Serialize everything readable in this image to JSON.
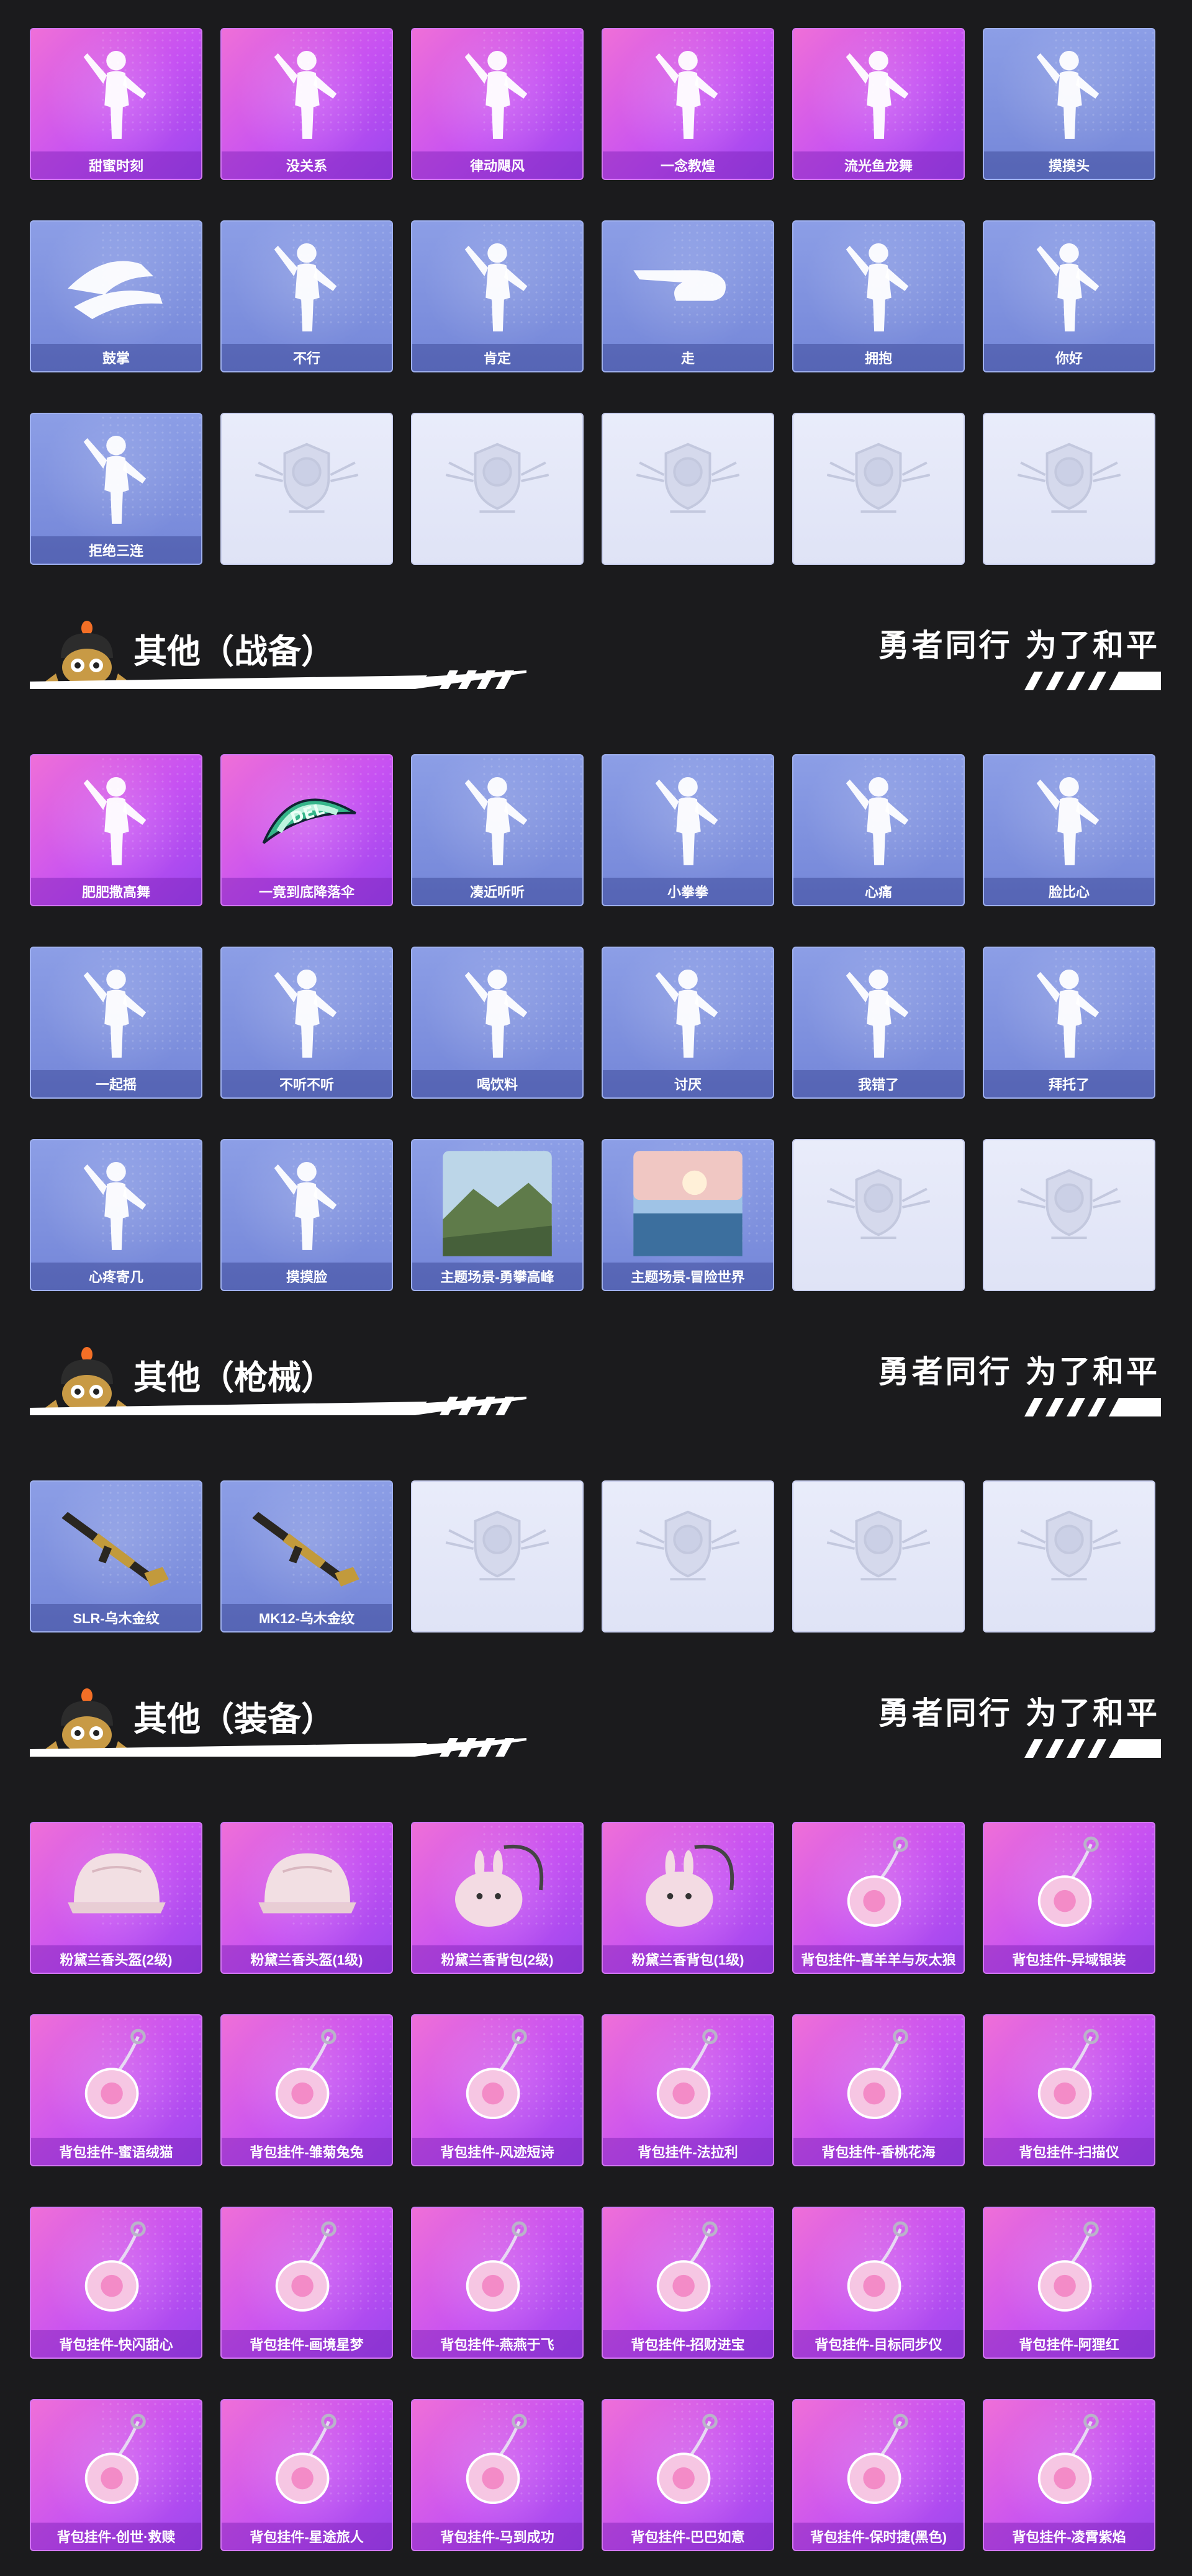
{
  "sections": [
    {
      "title": "其他（战备）",
      "slogan": "勇者同行 为了和平"
    },
    {
      "title": "其他（枪械）",
      "slogan": "勇者同行 为了和平"
    },
    {
      "title": "其他（装备）",
      "slogan": "勇者同行 为了和平"
    }
  ],
  "grid1": [
    {
      "label": "甜蜜时刻",
      "style": "pink",
      "icon": "dancer-figure-icon"
    },
    {
      "label": "没关系",
      "style": "pink",
      "icon": "dancer-figure-icon"
    },
    {
      "label": "律动飓风",
      "style": "pink",
      "icon": "dancer-figure-icon"
    },
    {
      "label": "一念教煌",
      "style": "pink",
      "icon": "dancer-figure-icon"
    },
    {
      "label": "流光鱼龙舞",
      "style": "pink",
      "icon": "dancer-figure-icon"
    },
    {
      "label": "摸摸头",
      "style": "blue",
      "icon": "figure-pat-head-icon"
    },
    {
      "label": "鼓掌",
      "style": "blue",
      "icon": "clapping-hands-icon"
    },
    {
      "label": "不行",
      "style": "blue",
      "icon": "head-shake-icon"
    },
    {
      "label": "肯定",
      "style": "blue",
      "icon": "head-nod-icon"
    },
    {
      "label": "走",
      "style": "blue",
      "icon": "pointing-hand-icon"
    },
    {
      "label": "拥抱",
      "style": "blue",
      "icon": "hug-figure-icon"
    },
    {
      "label": "你好",
      "style": "blue",
      "icon": "wave-figure-icon"
    },
    {
      "label": "拒绝三连",
      "style": "blue",
      "icon": "crossed-arms-figure-icon"
    },
    {
      "label": "",
      "style": "empty",
      "icon": "emblem-placeholder-icon"
    },
    {
      "label": "",
      "style": "empty",
      "icon": "emblem-placeholder-icon"
    },
    {
      "label": "",
      "style": "empty",
      "icon": "emblem-placeholder-icon"
    },
    {
      "label": "",
      "style": "empty",
      "icon": "emblem-placeholder-icon"
    },
    {
      "label": "",
      "style": "empty",
      "icon": "emblem-placeholder-icon"
    }
  ],
  "grid2": [
    {
      "label": "肥肥撒高舞",
      "style": "pink",
      "icon": "dancer-figure-icon"
    },
    {
      "label": "一竟到底降落伞",
      "style": "pink",
      "icon": "parachute-icon"
    },
    {
      "label": "凑近听听",
      "style": "blue",
      "icon": "listen-figure-icon"
    },
    {
      "label": "小拳拳",
      "style": "blue",
      "icon": "fist-figure-icon"
    },
    {
      "label": "心痛",
      "style": "blue",
      "icon": "heartache-figure-icon"
    },
    {
      "label": "脸比心",
      "style": "blue",
      "icon": "heart-face-figure-icon"
    },
    {
      "label": "一起摇",
      "style": "blue",
      "icon": "sway-figure-icon"
    },
    {
      "label": "不听不听",
      "style": "blue",
      "icon": "cover-ears-figure-icon"
    },
    {
      "label": "喝饮料",
      "style": "blue",
      "icon": "drink-figure-icon"
    },
    {
      "label": "讨厌",
      "style": "blue",
      "icon": "annoyed-figure-icon"
    },
    {
      "label": "我错了",
      "style": "blue",
      "icon": "sorry-figure-icon"
    },
    {
      "label": "拜托了",
      "style": "blue",
      "icon": "pray-figure-icon"
    },
    {
      "label": "心疼寄几",
      "style": "blue",
      "icon": "self-hug-figure-icon"
    },
    {
      "label": "摸摸脸",
      "style": "blue",
      "icon": "touch-face-figure-icon"
    },
    {
      "label": "主题场景-勇攀高峰",
      "style": "blue",
      "icon": "mountain-scene-icon"
    },
    {
      "label": "主题场景-冒险世界",
      "style": "blue",
      "icon": "sea-scene-icon"
    },
    {
      "label": "",
      "style": "empty",
      "icon": "emblem-placeholder-icon"
    },
    {
      "label": "",
      "style": "empty",
      "icon": "emblem-placeholder-icon"
    }
  ],
  "grid3": [
    {
      "label": "SLR-乌木金纹",
      "style": "blue",
      "icon": "rifle-icon"
    },
    {
      "label": "MK12-乌木金纹",
      "style": "blue",
      "icon": "rifle-icon"
    },
    {
      "label": "",
      "style": "empty",
      "icon": "emblem-placeholder-icon"
    },
    {
      "label": "",
      "style": "empty",
      "icon": "emblem-placeholder-icon"
    },
    {
      "label": "",
      "style": "empty",
      "icon": "emblem-placeholder-icon"
    },
    {
      "label": "",
      "style": "empty",
      "icon": "emblem-placeholder-icon"
    }
  ],
  "grid4": [
    {
      "label": "粉黛兰香头盔(2级)",
      "style": "pink",
      "icon": "helmet-icon"
    },
    {
      "label": "粉黛兰香头盔(1级)",
      "style": "pink",
      "icon": "helmet-icon"
    },
    {
      "label": "粉黛兰香背包(2级)",
      "style": "pink",
      "icon": "backpack-icon"
    },
    {
      "label": "粉黛兰香背包(1级)",
      "style": "pink",
      "icon": "backpack-icon"
    },
    {
      "label": "背包挂件-喜羊羊与灰太狼",
      "style": "pink",
      "icon": "charm-icon"
    },
    {
      "label": "背包挂件-异域银装",
      "style": "pink",
      "icon": "charm-icon"
    },
    {
      "label": "背包挂件-蜜语绒猫",
      "style": "pink",
      "icon": "charm-icon"
    },
    {
      "label": "背包挂件-雏菊兔兔",
      "style": "pink",
      "icon": "charm-icon"
    },
    {
      "label": "背包挂件-风迹短诗",
      "style": "pink",
      "icon": "charm-icon"
    },
    {
      "label": "背包挂件-法拉利",
      "style": "pink",
      "icon": "charm-icon"
    },
    {
      "label": "背包挂件-香桃花海",
      "style": "pink",
      "icon": "charm-icon"
    },
    {
      "label": "背包挂件-扫描仪",
      "style": "pink",
      "icon": "charm-icon"
    },
    {
      "label": "背包挂件-快闪甜心",
      "style": "pink",
      "icon": "charm-icon"
    },
    {
      "label": "背包挂件-画境星梦",
      "style": "pink",
      "icon": "charm-icon"
    },
    {
      "label": "背包挂件-燕燕于飞",
      "style": "pink",
      "icon": "charm-icon"
    },
    {
      "label": "背包挂件-招财进宝",
      "style": "pink",
      "icon": "charm-icon"
    },
    {
      "label": "背包挂件-目标同步仪",
      "style": "pink",
      "icon": "charm-icon"
    },
    {
      "label": "背包挂件-阿狸红",
      "style": "pink",
      "icon": "charm-icon"
    },
    {
      "label": "背包挂件-创世·救赎",
      "style": "pink",
      "icon": "charm-icon"
    },
    {
      "label": "背包挂件-星途旅人",
      "style": "pink",
      "icon": "charm-icon"
    },
    {
      "label": "背包挂件-马到成功",
      "style": "pink",
      "icon": "charm-icon"
    },
    {
      "label": "背包挂件-巴巴如意",
      "style": "pink",
      "icon": "charm-icon"
    },
    {
      "label": "背包挂件-保时捷(黑色)",
      "style": "pink",
      "icon": "charm-icon"
    },
    {
      "label": "背包挂件-凌霄紫焰",
      "style": "pink",
      "icon": "charm-icon"
    }
  ]
}
